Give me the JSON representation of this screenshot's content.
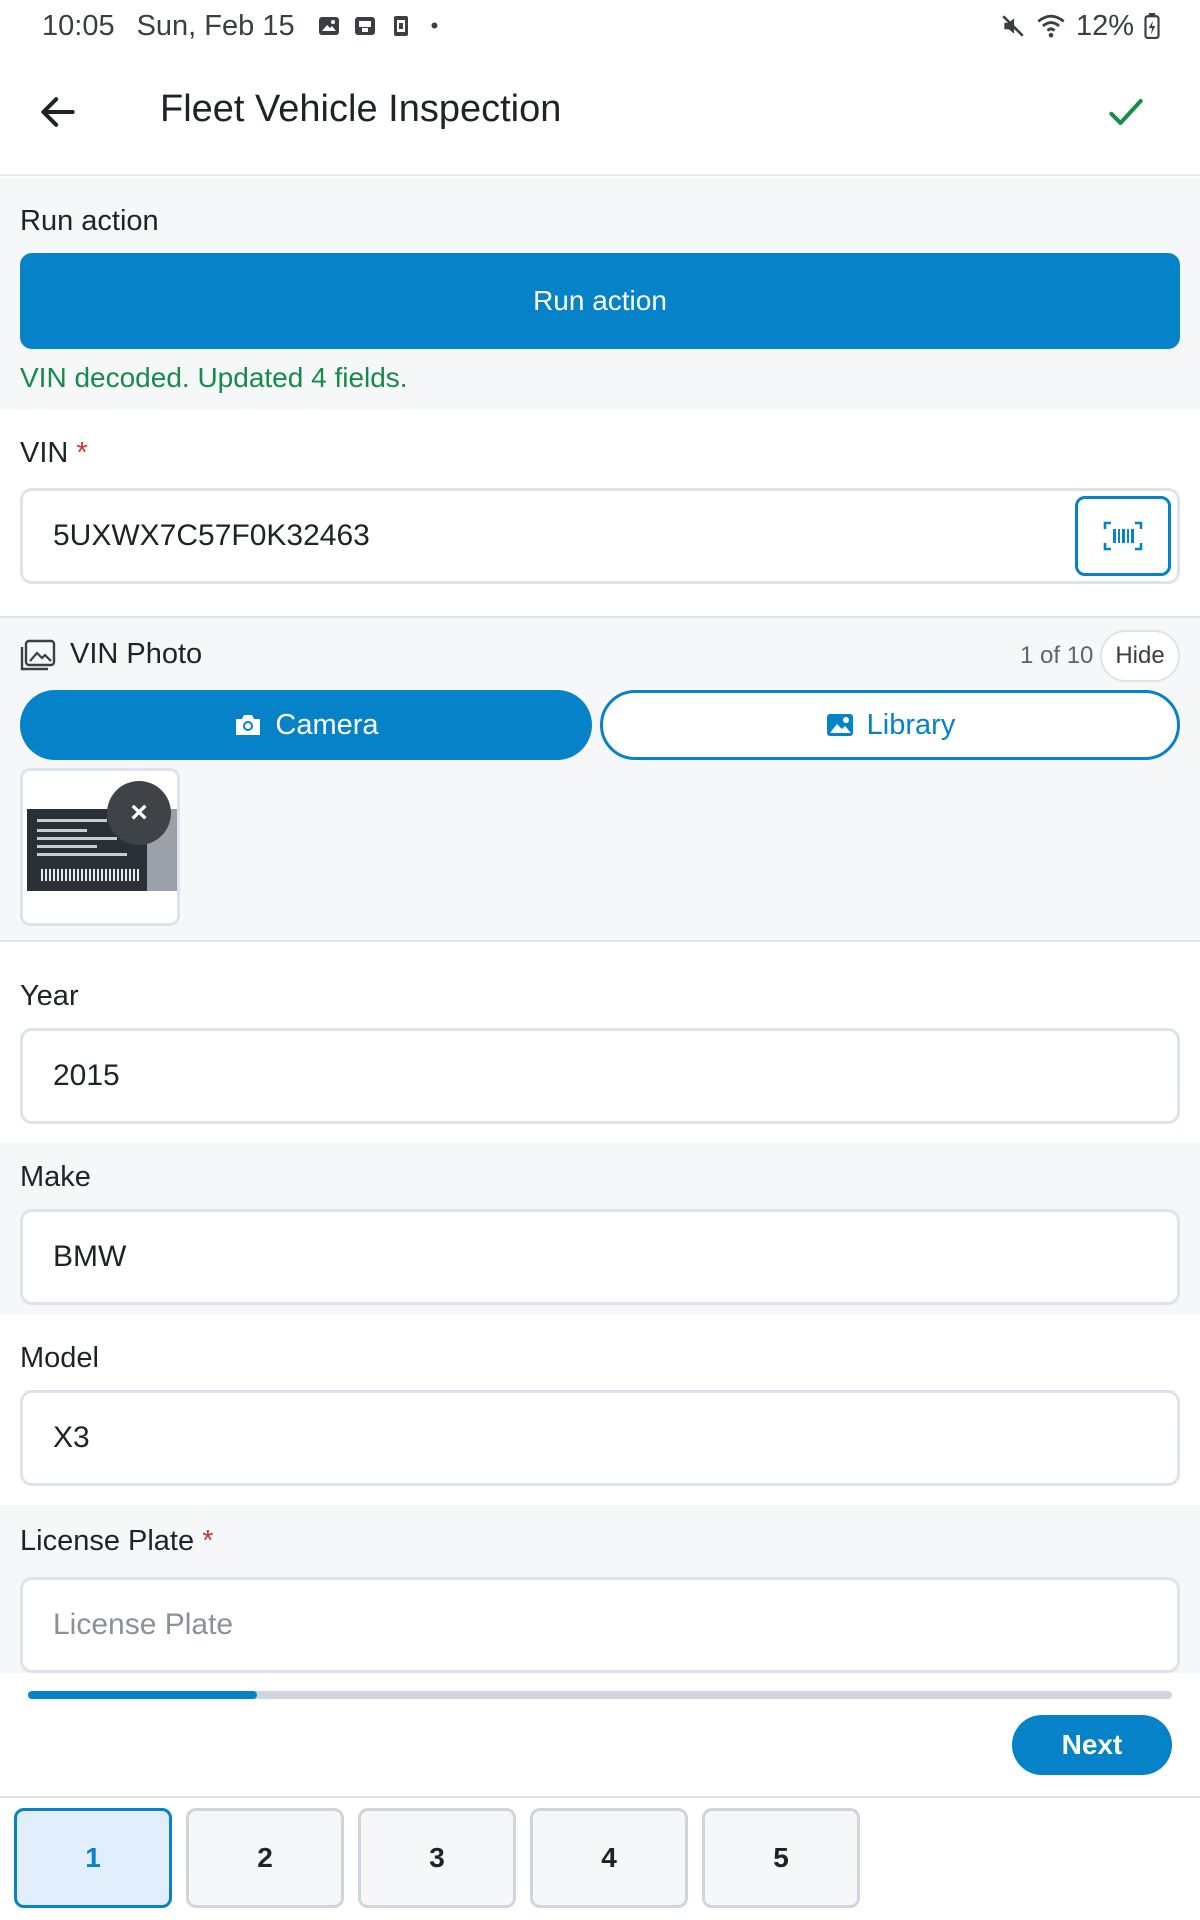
{
  "status_bar": {
    "time": "10:05",
    "date": "Sun, Feb 15",
    "battery": "12%"
  },
  "app_bar": {
    "title": "Fleet Vehicle Inspection"
  },
  "run_action": {
    "label": "Run action",
    "button_label": "Run action",
    "result_message": "VIN decoded. Updated 4 fields."
  },
  "vin": {
    "label": "VIN",
    "required_mark": "*",
    "value": "5UXWX7C57F0K32463"
  },
  "vin_photo": {
    "label": "VIN Photo",
    "counter": "1 of 10",
    "hide_label": "Hide",
    "camera_label": "Camera",
    "library_label": "Library",
    "remove_glyph": "×"
  },
  "year": {
    "label": "Year",
    "value": "2015"
  },
  "make": {
    "label": "Make",
    "value": "BMW"
  },
  "model": {
    "label": "Model",
    "value": "X3"
  },
  "license_plate": {
    "label": "License Plate",
    "required_mark": "*",
    "value": "",
    "placeholder": "License Plate"
  },
  "progress": {
    "fraction": 0.2
  },
  "footer": {
    "next_label": "Next"
  },
  "pager": {
    "pages": [
      "1",
      "2",
      "3",
      "4",
      "5"
    ],
    "active_index": 0
  },
  "colors": {
    "accent": "#0682c8",
    "success": "#178a4c",
    "required": "#d0342c"
  }
}
